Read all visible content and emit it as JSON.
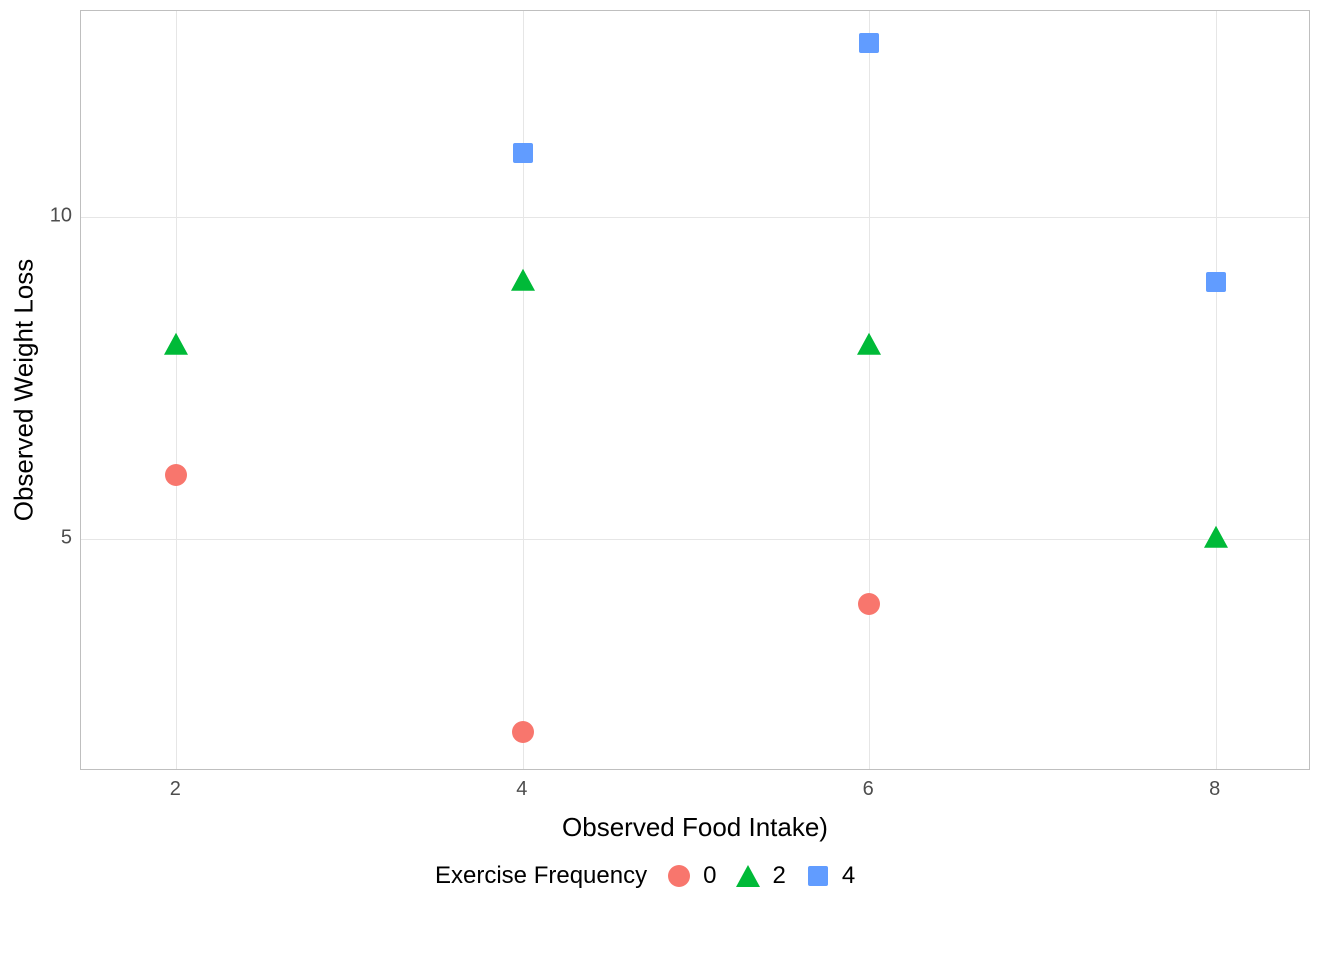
{
  "chart_data": {
    "type": "scatter",
    "xlabel": "Observed Food Intake)",
    "ylabel": "Observed Weight Loss",
    "xlim": [
      1.45,
      8.55
    ],
    "ylim": [
      1.4,
      13.2
    ],
    "x_ticks": [
      2,
      4,
      6,
      8
    ],
    "y_ticks": [
      5,
      10
    ],
    "legend_title": "Exercise Frequency",
    "legend_position": "bottom",
    "grid": true,
    "series": [
      {
        "name": "0",
        "shape": "circle",
        "color": "#F8766D",
        "points": [
          {
            "x": 2,
            "y": 6
          },
          {
            "x": 4,
            "y": 2
          },
          {
            "x": 6,
            "y": 4
          }
        ]
      },
      {
        "name": "2",
        "shape": "triangle",
        "color": "#00BA38",
        "points": [
          {
            "x": 2,
            "y": 8
          },
          {
            "x": 4,
            "y": 9
          },
          {
            "x": 6,
            "y": 8
          },
          {
            "x": 8,
            "y": 5
          }
        ]
      },
      {
        "name": "4",
        "shape": "square",
        "color": "#619CFF",
        "points": [
          {
            "x": 4,
            "y": 11
          },
          {
            "x": 6,
            "y": 12.7
          },
          {
            "x": 8,
            "y": 9
          }
        ]
      }
    ]
  }
}
